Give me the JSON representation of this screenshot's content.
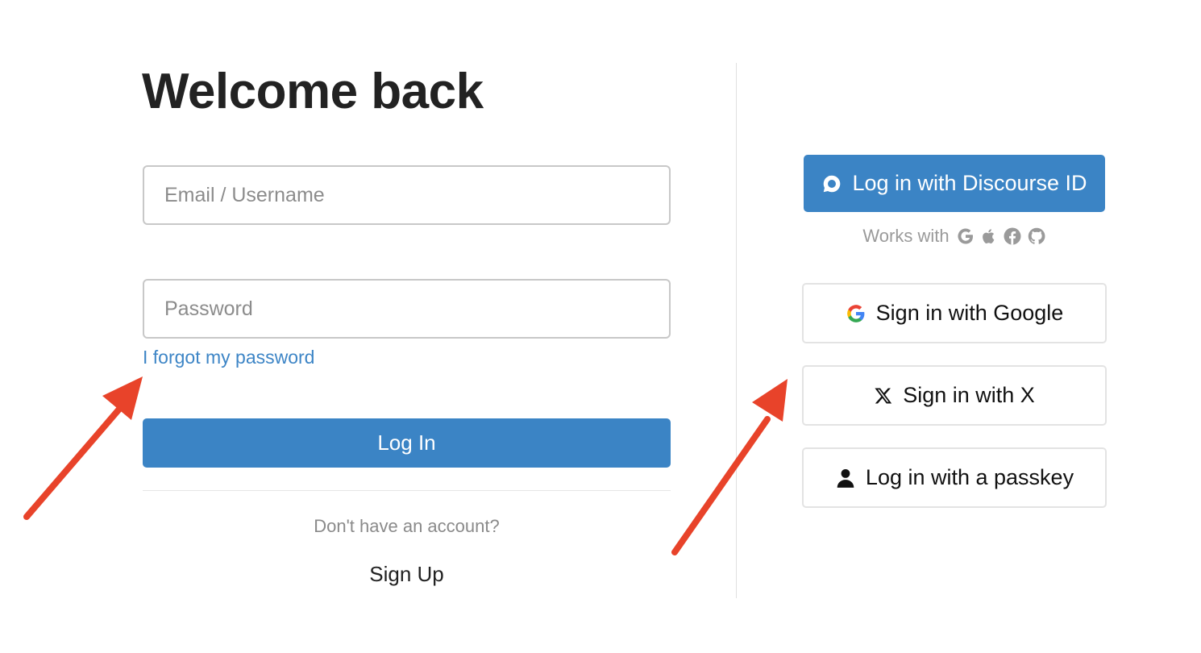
{
  "header": {
    "title": "Welcome back"
  },
  "form": {
    "email_placeholder": "Email / Username",
    "password_placeholder": "Password",
    "forgot_label": "I forgot my password",
    "login_label": "Log In",
    "no_account_label": "Don't have an account?",
    "signup_label": "Sign Up"
  },
  "sso": {
    "discourse_label": "Log in with Discourse ID",
    "works_with_label": "Works with",
    "works_with_icons": [
      "google-icon",
      "apple-icon",
      "facebook-icon",
      "github-icon"
    ],
    "google_label": "Sign in with Google",
    "x_label": "Sign in with X",
    "passkey_label": "Log in with a passkey"
  },
  "colors": {
    "primary": "#3b84c5",
    "link": "#3d85c6",
    "annotation_arrow": "#e8432a"
  }
}
